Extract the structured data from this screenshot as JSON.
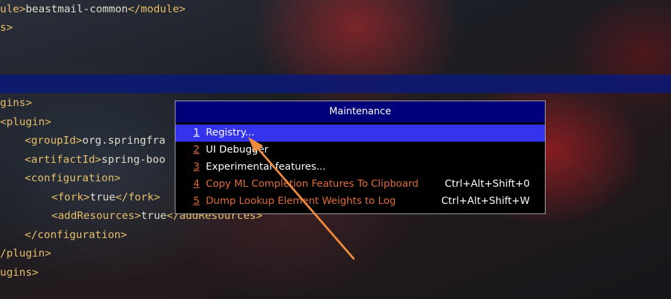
{
  "editor": {
    "lines": [
      {
        "indent": "ule>",
        "tag_open": "",
        "text": "beastmail-common",
        "tag_close": "</module>",
        "prefix": "ule>"
      },
      {
        "prefix": "s>"
      },
      {
        "prefix": ""
      },
      {
        "prefix": ""
      },
      {
        "prefix": "gins>"
      },
      {
        "prefix": "<plugin>"
      },
      {
        "prefix": "<groupId>",
        "text": "org.springfra"
      },
      {
        "prefix": "<artifactId>",
        "text": "spring-boo"
      },
      {
        "prefix": "<configuration>"
      },
      {
        "prefix": "<fork>",
        "text": "true",
        "suffix": "</fork>"
      },
      {
        "prefix": "<addResources>",
        "text": "true",
        "suffix": "</addResources>"
      },
      {
        "prefix": "</configuration>"
      },
      {
        "prefix": "/plugin>"
      },
      {
        "prefix": "ugins>"
      }
    ],
    "line0_a": "ule>",
    "line0_b": "beastmail-common",
    "line0_c": "</module>",
    "line1": "s>",
    "line4": "gins>",
    "line5": "<plugin>",
    "line6_a": "<groupId>",
    "line6_b": "org.springfra",
    "line7_a": "<artifactId>",
    "line7_b": "spring-boo",
    "line8": "<configuration>",
    "line9_a": "<fork>",
    "line9_b": "true",
    "line9_c": "</fork>",
    "line10_a": "<addResources>",
    "line10_b": "true",
    "line10_c": "</addResources>",
    "line11": "</configuration>",
    "line12": "/plugin>",
    "line13": "ugins>"
  },
  "popup": {
    "title": "Maintenance",
    "items": [
      {
        "num": "1",
        "label": "Registry...",
        "shortcut": ""
      },
      {
        "num": "2",
        "label": "UI Debugger",
        "shortcut": ""
      },
      {
        "num": "3",
        "label": "Experimental features...",
        "shortcut": ""
      },
      {
        "num": "4",
        "label": "Copy ML Completion Features To Clipboard",
        "shortcut": "Ctrl+Alt+Shift+0"
      },
      {
        "num": "5",
        "label": "Dump Lookup Element Weights to Log",
        "shortcut": "Ctrl+Alt+Shift+W"
      }
    ]
  },
  "colors": {
    "selection": "#3433ee",
    "title_bar": "#00007a",
    "accent": "#e06c3a",
    "arrow": "#f08a3c"
  }
}
